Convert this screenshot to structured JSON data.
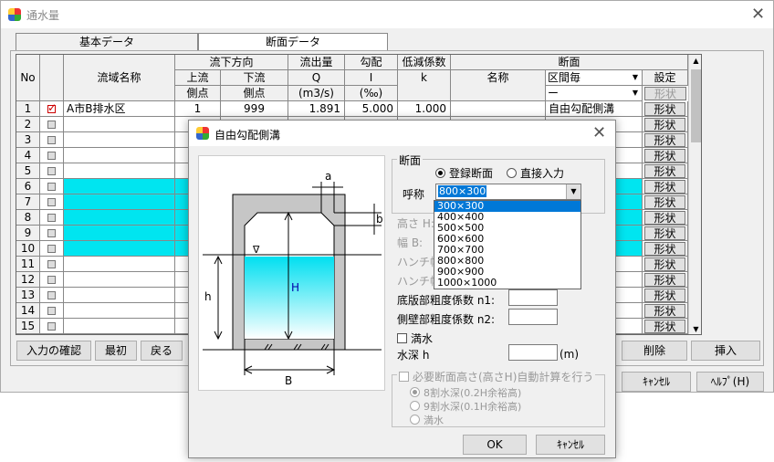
{
  "main_window": {
    "title": "通水量",
    "tabs": [
      "基本データ",
      "断面データ"
    ],
    "header": {
      "no": "No",
      "name": "流域名称",
      "flow_dir": "流下方向",
      "upstream": "上流",
      "upstream2": "側点",
      "downstream": "下流",
      "downstream2": "側点",
      "discharge": "流出量",
      "discharge_sym": "Q",
      "discharge_unit": "(m3/s)",
      "slope": "勾配",
      "slope_sym": "I",
      "slope_unit": "(‰)",
      "reduction": "低減係数",
      "reduction_sym": "k",
      "section": "断面",
      "sec_name": "名称",
      "sec_mode": "区間毎",
      "sec_sub": "ー",
      "setting": "設定",
      "shape_header": "形状"
    },
    "rows": [
      {
        "no": "1",
        "name": "A市B排水区",
        "up": "1",
        "down": "999",
        "q": "1.891",
        "i": "5.000",
        "k": "1.000",
        "section": "自由勾配側溝",
        "shape": "形状"
      },
      {
        "no": "2",
        "shape": "形状"
      },
      {
        "no": "3",
        "shape": "形状"
      },
      {
        "no": "4",
        "shape": "形状"
      },
      {
        "no": "5",
        "shape": "形状"
      },
      {
        "no": "6",
        "shape": "形状"
      },
      {
        "no": "7",
        "shape": "形状"
      },
      {
        "no": "8",
        "shape": "形状"
      },
      {
        "no": "9",
        "shape": "形状"
      },
      {
        "no": "10",
        "shape": "形状"
      },
      {
        "no": "11",
        "shape": "形状"
      },
      {
        "no": "12",
        "shape": "形状"
      },
      {
        "no": "13",
        "shape": "形状"
      },
      {
        "no": "14",
        "shape": "形状"
      },
      {
        "no": "15",
        "shape": "形状"
      }
    ],
    "buttons": {
      "confirm": "入力の確認",
      "first": "最初",
      "back": "戻る",
      "delete": "削除",
      "insert": "挿入",
      "cancel": "ｷｬﾝｾﾙ",
      "help": "ﾍﾙﾌﾟ(H)"
    },
    "highlight_color": "#00e5f0"
  },
  "dialog": {
    "title": "自由勾配側溝",
    "section_group": "断面",
    "radio_registered": "登録断面",
    "radio_direct": "直接入力",
    "nominal_label": "呼称",
    "nominal_value": "800×300",
    "options": [
      "300×300",
      "400×400",
      "500×500",
      "600×600",
      "700×700",
      "800×800",
      "900×900",
      "1000×1000"
    ],
    "height_label": "高さ H:",
    "width_label": "幅 B:",
    "haunch1": "ハンチ幅",
    "haunch2": "ハンチ幅",
    "bottom_rough": "底版部粗度係数 n1:",
    "side_rough": "側壁部粗度係数 n2:",
    "full_water": "満水",
    "water_depth": "水深 h",
    "depth_unit": "(m)",
    "auto_calc": "必要断面高さ(高さH)自動計算を行う",
    "auto_opt1": "8割水深(0.2H余裕高)",
    "auto_opt2": "9割水深(0.1H余裕高)",
    "auto_opt3": "満水",
    "ok": "OK",
    "cancel": "ｷｬﾝｾﾙ",
    "diagram": {
      "a": "a",
      "b": "b",
      "H": "H",
      "h": "h",
      "B": "B",
      "water_mark": "∇"
    }
  }
}
